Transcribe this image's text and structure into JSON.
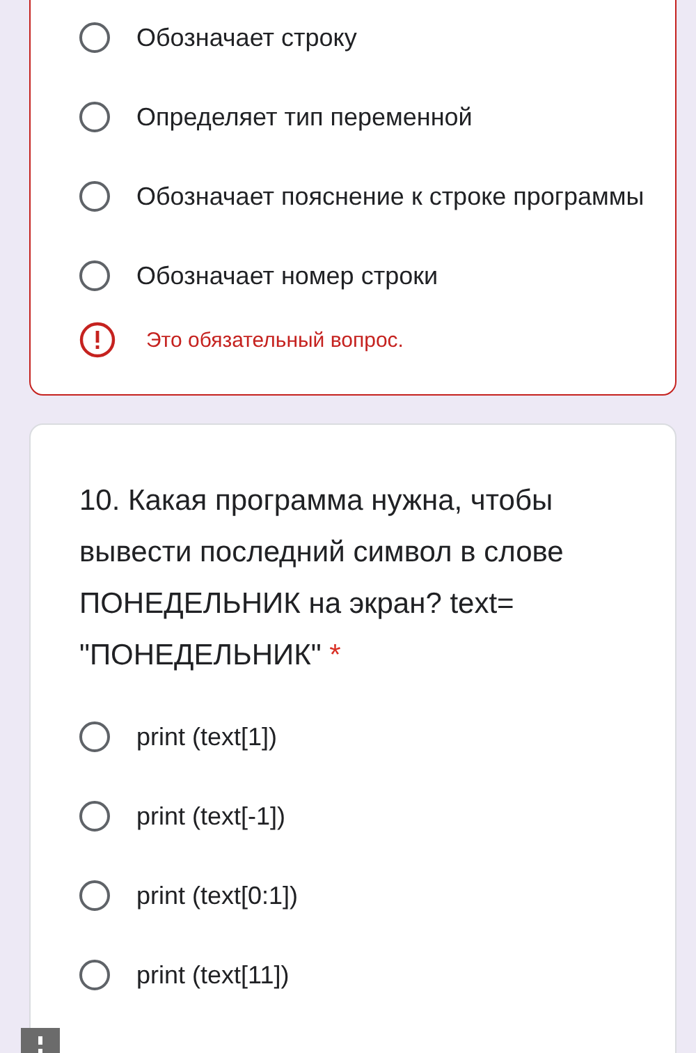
{
  "questions": [
    {
      "options": [
        {
          "label": "Обозначает строку",
          "selected": false
        },
        {
          "label": "Определяет тип переменной",
          "selected": false
        },
        {
          "label": "Обозначает пояснение к строке программы",
          "selected": false
        },
        {
          "label": "Обозначает номер строки",
          "selected": false
        }
      ],
      "error": "Это обязательный вопрос."
    },
    {
      "title": "10. Какая программа нужна, чтобы вывести последний символ в слове ПОНЕДЕЛЬНИК на экран? text= \"ПОНЕДЕЛЬНИК\"",
      "required_mark": "*",
      "options": [
        {
          "label": "print (text[1])",
          "selected": false
        },
        {
          "label": "print (text[-1])",
          "selected": false
        },
        {
          "label": "print (text[0:1])",
          "selected": false
        },
        {
          "label": "print (text[11])",
          "selected": false
        }
      ]
    }
  ]
}
